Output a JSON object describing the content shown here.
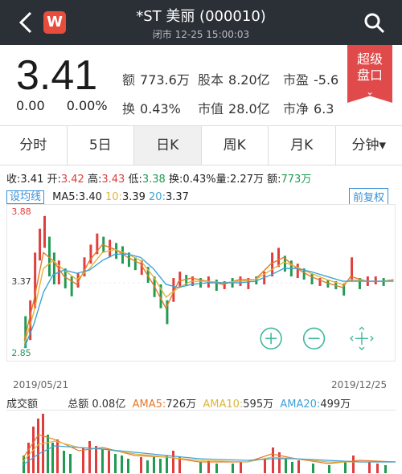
{
  "header": {
    "logo_letter": "W",
    "title": "*ST 美丽 (000010)",
    "status": "闭市 12-25 15:00:03"
  },
  "quote": {
    "price": "3.41",
    "change": "0.00",
    "change_pct": "0.00%",
    "stats": [
      {
        "k": "额",
        "v": "773.6万"
      },
      {
        "k": "股本",
        "v": "8.20亿"
      },
      {
        "k": "市盈",
        "v": "-5.6"
      },
      {
        "k": "换",
        "v": "0.43%"
      },
      {
        "k": "市值",
        "v": "28.0亿"
      },
      {
        "k": "市净",
        "v": "6.3"
      }
    ],
    "badge": [
      "超级",
      "盘口"
    ]
  },
  "tabs": [
    {
      "label": "分时"
    },
    {
      "label": "5日"
    },
    {
      "label": "日K"
    },
    {
      "label": "周K"
    },
    {
      "label": "月K"
    },
    {
      "label": "分钟▾"
    }
  ],
  "info": {
    "close_label": "收:",
    "close": "3.41",
    "open_label": "开:",
    "open": "3.42",
    "high_label": "高:",
    "high": "3.43",
    "low_label": "低:",
    "low": "3.38",
    "turn_label": "换:",
    "turn": "0.43%",
    "vol_label": "量:",
    "vol": "2.27万",
    "amt_label": "额:",
    "amt": "773万"
  },
  "ma": {
    "set_label": "设均线",
    "ma5_label": "MA5:",
    "ma5": "3.40",
    "ma10_label": "10:",
    "ma10": "3.39",
    "ma20_label": "20:",
    "ma20": "3.37",
    "adjust": "前复权"
  },
  "axis": {
    "y_top": "3.88",
    "y_mid": "3.37",
    "y_low": "2.85",
    "date_start": "2019/05/21",
    "date_end": "2019/12/25"
  },
  "volume": {
    "title": "成交额",
    "total_label": "总额",
    "total": "0.08亿",
    "ama5_label": "AMA5:",
    "ama5": "726万",
    "ama10_label": "AMA10:",
    "ama10": "595万",
    "ama20_label": "AMA20:",
    "ama20": "499万"
  },
  "colors": {
    "up": "#e03d3d",
    "down": "#1f9b52",
    "ma5": "#e6792c",
    "ma10": "#e0b63a",
    "ma20": "#3fa3d6"
  }
}
